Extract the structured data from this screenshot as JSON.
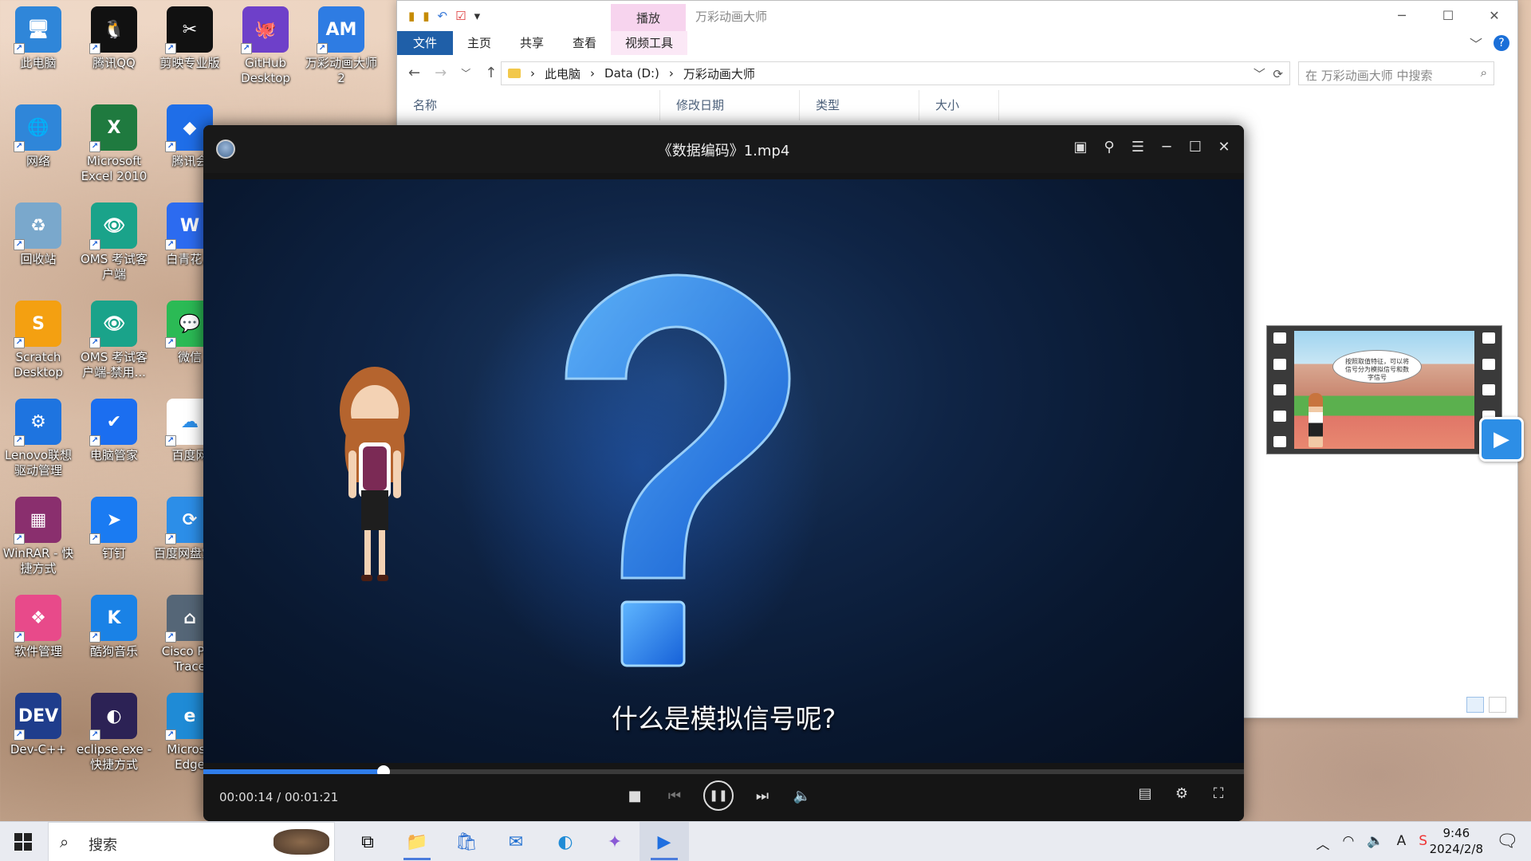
{
  "desktop": {
    "icons": [
      {
        "label": "此电脑",
        "icon": "computer-icon",
        "color": "#2f86d9",
        "glyph": "🖥"
      },
      {
        "label": "腾讯QQ",
        "icon": "qq-icon",
        "color": "#111111",
        "glyph": "🐧"
      },
      {
        "label": "剪映专业版",
        "icon": "jianying-icon",
        "color": "#111111",
        "glyph": "✂"
      },
      {
        "label": "GitHub Desktop",
        "icon": "github-icon",
        "color": "#6e40c9",
        "glyph": "🐙"
      },
      {
        "label": "万彩动画大师 2",
        "icon": "animation-master-icon",
        "color": "#2e7ce3",
        "glyph": "AM"
      },
      {
        "label": "网络",
        "icon": "network-icon",
        "color": "#2f86d9",
        "glyph": "🌐"
      },
      {
        "label": "Microsoft Excel 2010",
        "icon": "excel-icon",
        "color": "#1f7a3f",
        "glyph": "X"
      },
      {
        "label": "腾讯会",
        "icon": "tencent-meeting-icon",
        "color": "#1f6ee8",
        "glyph": "◆"
      },
      {
        "label": "回收站",
        "icon": "recycle-bin-icon",
        "color": "#7aa8cc",
        "glyph": "♻"
      },
      {
        "label": "OMS 考试客户端",
        "icon": "oms-icon",
        "color": "#1aa38a",
        "glyph": "👁"
      },
      {
        "label": "白青花.d",
        "icon": "wps-doc-icon",
        "color": "#2c6bf0",
        "glyph": "W"
      },
      {
        "label": "Scratch Desktop",
        "icon": "scratch-icon",
        "color": "#f4a011",
        "glyph": "S"
      },
      {
        "label": "OMS 考试客户端-禁用...",
        "icon": "oms-disabled-icon",
        "color": "#1aa38a",
        "glyph": "👁"
      },
      {
        "label": "微信",
        "icon": "wechat-icon",
        "color": "#2bba55",
        "glyph": "💬"
      },
      {
        "label": "Lenovo联想驱动管理",
        "icon": "lenovo-driver-icon",
        "color": "#1e74e0",
        "glyph": "⚙"
      },
      {
        "label": "电脑管家",
        "icon": "pc-manager-icon",
        "color": "#1b6ef0",
        "glyph": "✔"
      },
      {
        "label": "百度网",
        "icon": "baidu-netdisk-icon",
        "color": "#ffffff",
        "glyph": "☁"
      },
      {
        "label": "WinRAR - 快捷方式",
        "icon": "winrar-icon",
        "color": "#8a2f6e",
        "glyph": "▦"
      },
      {
        "label": "钉钉",
        "icon": "dingtalk-icon",
        "color": "#1a7bf2",
        "glyph": "➤"
      },
      {
        "label": "百度网盘空间",
        "icon": "baidu-space-icon",
        "color": "#2c8ee8",
        "glyph": "⟳"
      },
      {
        "label": "软件管理",
        "icon": "software-manager-icon",
        "color": "#e84a8a",
        "glyph": "❖"
      },
      {
        "label": "酷狗音乐",
        "icon": "kugou-icon",
        "color": "#1a82e6",
        "glyph": "K"
      },
      {
        "label": "Cisco Pac Trace",
        "icon": "cisco-packet-tracer-icon",
        "color": "#556677",
        "glyph": "⌂"
      },
      {
        "label": "Dev-C++",
        "icon": "devcpp-icon",
        "color": "#1f3d8c",
        "glyph": "DEV"
      },
      {
        "label": "eclipse.exe - 快捷方式",
        "icon": "eclipse-icon",
        "color": "#2c2255",
        "glyph": "◐"
      },
      {
        "label": "Microso Edge",
        "icon": "edge-icon",
        "color": "#1f8bd6",
        "glyph": "e"
      }
    ]
  },
  "explorer": {
    "ribbon_context_tab": "播放",
    "window_title": "万彩动画大师",
    "tabs": [
      "文件",
      "主页",
      "共享",
      "查看",
      "视频工具"
    ],
    "breadcrumb": [
      "此电脑",
      "Data (D:)",
      "万彩动画大师"
    ],
    "search_placeholder": "在 万彩动画大师 中搜索",
    "columns": [
      "名称",
      "修改日期",
      "类型",
      "大小"
    ],
    "thumbnail_bubble": "按照取值特征，可以将信号分为模拟信号和数字信号"
  },
  "player": {
    "title": "《数据编码》1.mp4",
    "subtitle": "什么是模拟信号呢?",
    "time_current": "00:00:14",
    "time_total": "00:01:21",
    "progress": 0.1728,
    "accent": "#2f7dea"
  },
  "taskbar": {
    "search_placeholder": "搜索",
    "time": "9:46",
    "date": "2024/2/8"
  }
}
